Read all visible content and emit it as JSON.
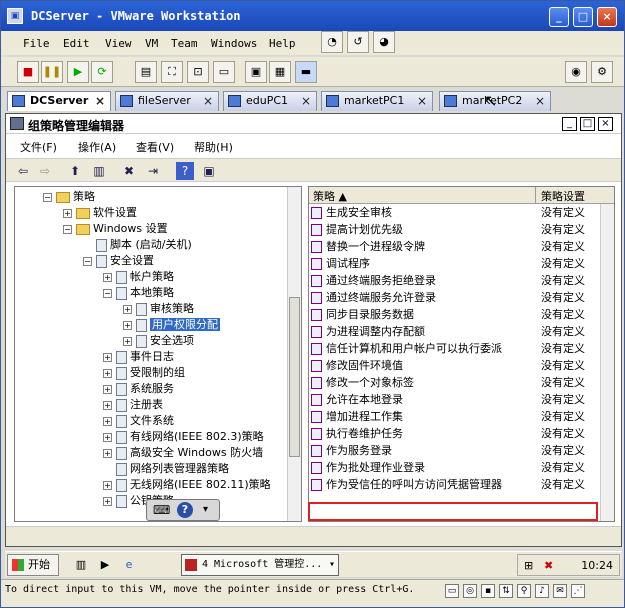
{
  "window": {
    "title": "DCServer - VMware Workstation",
    "icon": "vm-icon"
  },
  "window_controls": {
    "minimize": "_",
    "maximize": "□",
    "close": "×"
  },
  "menubar": [
    "File",
    "Edit",
    "View",
    "VM",
    "Team",
    "Windows",
    "Help"
  ],
  "tabs": [
    {
      "label": "DCServer",
      "active": true
    },
    {
      "label": "fileServer"
    },
    {
      "label": "eduPC1"
    },
    {
      "label": "marketPC1"
    },
    {
      "label": "marketPC2"
    }
  ],
  "tab_close": "×",
  "gp": {
    "title": "组策略管理编辑器",
    "menu": [
      "文件(F)",
      "操作(A)",
      "查看(V)",
      "帮助(H)"
    ],
    "controls": {
      "minimize": "_",
      "restore": "□",
      "close": "×"
    }
  },
  "tree": [
    {
      "label": "策略",
      "indent": 0,
      "exp": "−",
      "kind": "folder"
    },
    {
      "label": "软件设置",
      "indent": 1,
      "exp": "+",
      "kind": "folder"
    },
    {
      "label": "Windows 设置",
      "indent": 1,
      "exp": "−",
      "kind": "folder"
    },
    {
      "label": "脚本 (启动/关机)",
      "indent": 2,
      "exp": "",
      "kind": "doc"
    },
    {
      "label": "安全设置",
      "indent": 2,
      "exp": "−",
      "kind": "doc"
    },
    {
      "label": "帐户策略",
      "indent": 3,
      "exp": "+",
      "kind": "doc"
    },
    {
      "label": "本地策略",
      "indent": 3,
      "exp": "−",
      "kind": "doc"
    },
    {
      "label": "审核策略",
      "indent": 4,
      "exp": "+",
      "kind": "doc"
    },
    {
      "label": "用户权限分配",
      "indent": 4,
      "exp": "+",
      "kind": "doc",
      "selected": true
    },
    {
      "label": "安全选项",
      "indent": 4,
      "exp": "+",
      "kind": "doc"
    },
    {
      "label": "事件日志",
      "indent": 3,
      "exp": "+",
      "kind": "doc"
    },
    {
      "label": "受限制的组",
      "indent": 3,
      "exp": "+",
      "kind": "doc"
    },
    {
      "label": "系统服务",
      "indent": 3,
      "exp": "+",
      "kind": "doc"
    },
    {
      "label": "注册表",
      "indent": 3,
      "exp": "+",
      "kind": "doc"
    },
    {
      "label": "文件系统",
      "indent": 3,
      "exp": "+",
      "kind": "doc"
    },
    {
      "label": "有线网络(IEEE 802.3)策略",
      "indent": 3,
      "exp": "+",
      "kind": "doc"
    },
    {
      "label": "高级安全 Windows 防火墙",
      "indent": 3,
      "exp": "+",
      "kind": "doc"
    },
    {
      "label": "网络列表管理器策略",
      "indent": 3,
      "exp": "",
      "kind": "doc"
    },
    {
      "label": "无线网络(IEEE 802.11)策略",
      "indent": 3,
      "exp": "+",
      "kind": "doc"
    },
    {
      "label": "公钥策略",
      "indent": 3,
      "exp": "+",
      "kind": "doc"
    }
  ],
  "list": {
    "headers": [
      "策略 ▲",
      "策略设置"
    ],
    "rows": [
      {
        "policy": "生成安全审核",
        "setting": "没有定义"
      },
      {
        "policy": "提高计划优先级",
        "setting": "没有定义"
      },
      {
        "policy": "替换一个进程级令牌",
        "setting": "没有定义"
      },
      {
        "policy": "调试程序",
        "setting": "没有定义"
      },
      {
        "policy": "通过终端服务拒绝登录",
        "setting": "没有定义"
      },
      {
        "policy": "通过终端服务允许登录",
        "setting": "没有定义"
      },
      {
        "policy": "同步目录服务数据",
        "setting": "没有定义"
      },
      {
        "policy": "为进程调整内存配额",
        "setting": "没有定义"
      },
      {
        "policy": "信任计算机和用户帐户可以执行委派",
        "setting": "没有定义"
      },
      {
        "policy": "修改固件环境值",
        "setting": "没有定义"
      },
      {
        "policy": "修改一个对象标签",
        "setting": "没有定义"
      },
      {
        "policy": "允许在本地登录",
        "setting": "没有定义",
        "highlight": true
      },
      {
        "policy": "增加进程工作集",
        "setting": "没有定义"
      },
      {
        "policy": "执行卷维护任务",
        "setting": "没有定义"
      },
      {
        "policy": "作为服务登录",
        "setting": "没有定义"
      },
      {
        "policy": "作为批处理作业登录",
        "setting": "没有定义"
      },
      {
        "policy": "作为受信任的呼叫方访问凭据管理器",
        "setting": "没有定义"
      }
    ]
  },
  "taskbar": {
    "start": "开始",
    "task": "4 Microsoft 管理控...",
    "clock": "10:24"
  },
  "status": {
    "text": "To direct input to this VM, move the pointer inside or press Ctrl+G."
  },
  "colors": {
    "titlebar": "#2c64d8",
    "selection": "#316ac5",
    "highlight_box": "#e02020"
  }
}
